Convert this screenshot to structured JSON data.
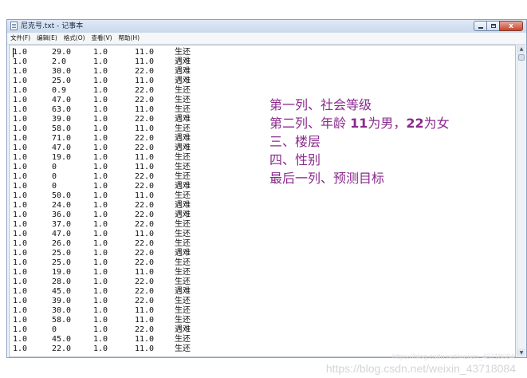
{
  "window": {
    "title": "尼克号.txt - 记事本",
    "close_glyph": "x"
  },
  "menu": [
    "文件(F)",
    "编辑(E)",
    "格式(O)",
    "查看(V)",
    "帮助(H)"
  ],
  "rows": [
    [
      "1.0",
      "29.0",
      "1.0",
      "11.0",
      "生还"
    ],
    [
      "1.0",
      "2.0",
      "1.0",
      "11.0",
      "遇难"
    ],
    [
      "1.0",
      "30.0",
      "1.0",
      "22.0",
      "遇难"
    ],
    [
      "1.0",
      "25.0",
      "1.0",
      "11.0",
      "遇难"
    ],
    [
      "1.0",
      "0.9",
      "1.0",
      "22.0",
      "生还"
    ],
    [
      "1.0",
      "47.0",
      "1.0",
      "22.0",
      "生还"
    ],
    [
      "1.0",
      "63.0",
      "1.0",
      "11.0",
      "生还"
    ],
    [
      "1.0",
      "39.0",
      "1.0",
      "22.0",
      "遇难"
    ],
    [
      "1.0",
      "58.0",
      "1.0",
      "11.0",
      "生还"
    ],
    [
      "1.0",
      "71.0",
      "1.0",
      "22.0",
      "遇难"
    ],
    [
      "1.0",
      "47.0",
      "1.0",
      "22.0",
      "遇难"
    ],
    [
      "1.0",
      "19.0",
      "1.0",
      "11.0",
      "生还"
    ],
    [
      "1.0",
      "0",
      "1.0",
      "11.0",
      "生还"
    ],
    [
      "1.0",
      "0",
      "1.0",
      "22.0",
      "生还"
    ],
    [
      "1.0",
      "0",
      "1.0",
      "22.0",
      "遇难"
    ],
    [
      "1.0",
      "50.0",
      "1.0",
      "11.0",
      "生还"
    ],
    [
      "1.0",
      "24.0",
      "1.0",
      "22.0",
      "遇难"
    ],
    [
      "1.0",
      "36.0",
      "1.0",
      "22.0",
      "遇难"
    ],
    [
      "1.0",
      "37.0",
      "1.0",
      "22.0",
      "生还"
    ],
    [
      "1.0",
      "47.0",
      "1.0",
      "11.0",
      "生还"
    ],
    [
      "1.0",
      "26.0",
      "1.0",
      "22.0",
      "生还"
    ],
    [
      "1.0",
      "25.0",
      "1.0",
      "22.0",
      "遇难"
    ],
    [
      "1.0",
      "25.0",
      "1.0",
      "22.0",
      "生还"
    ],
    [
      "1.0",
      "19.0",
      "1.0",
      "11.0",
      "生还"
    ],
    [
      "1.0",
      "28.0",
      "1.0",
      "22.0",
      "生还"
    ],
    [
      "1.0",
      "45.0",
      "1.0",
      "22.0",
      "遇难"
    ],
    [
      "1.0",
      "39.0",
      "1.0",
      "22.0",
      "生还"
    ],
    [
      "1.0",
      "30.0",
      "1.0",
      "11.0",
      "生还"
    ],
    [
      "1.0",
      "58.0",
      "1.0",
      "11.0",
      "生还"
    ],
    [
      "1.0",
      "0",
      "1.0",
      "22.0",
      "遇难"
    ],
    [
      "1.0",
      "45.0",
      "1.0",
      "11.0",
      "生还"
    ],
    [
      "1.0",
      "22.0",
      "1.0",
      "11.0",
      "生还"
    ]
  ],
  "annotation": {
    "line1": "第一列、社会等级",
    "line2_a": "第二列、年龄 ",
    "line2_b": "11",
    "line2_c": "为男，",
    "line2_d": "22",
    "line2_e": "为女",
    "line3": "三、楼层",
    "line4": "四、性别",
    "line5": "最后一列、预测目标"
  },
  "watermark": {
    "main": "https://blog.csdn.net/weixin_43718084",
    "small": "https://blog.csdn.net/weixin_43718084"
  },
  "colors": {
    "annotation": "#8a2a8c",
    "window_border": "#8aa1c2"
  }
}
